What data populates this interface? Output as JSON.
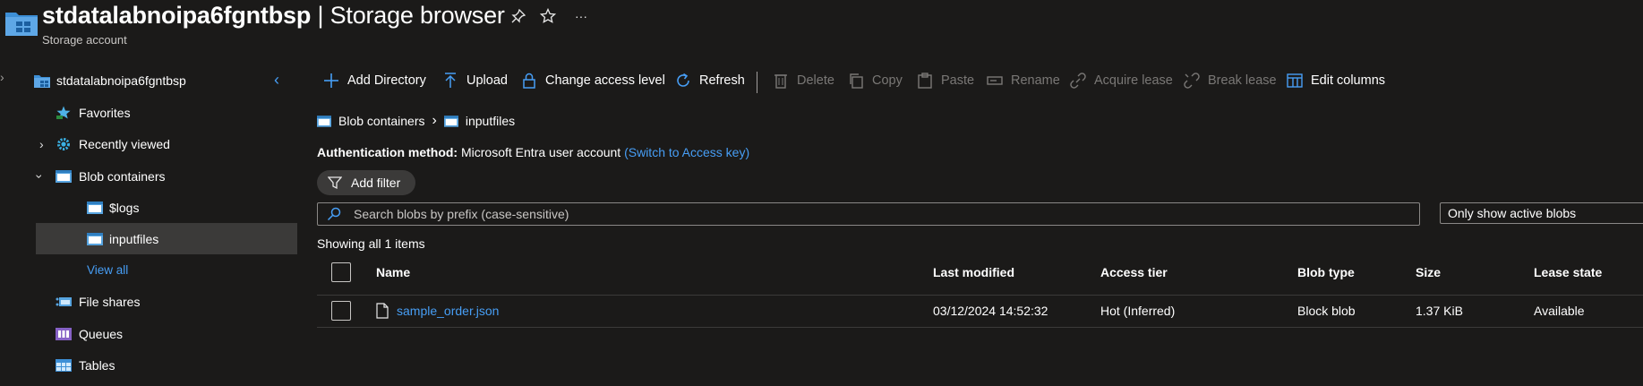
{
  "header": {
    "account_name": "stdatalabnoipa6fgntbsp",
    "separator": "|",
    "page_name": "Storage browser",
    "subtitle": "Storage account",
    "pin_icon": "pin-icon",
    "star_icon": "star-icon",
    "more_label": "···"
  },
  "sidebar": {
    "account_label": "stdatalabnoipa6fgntbsp",
    "items": [
      {
        "label": "Favorites",
        "icon": "favorites-icon"
      },
      {
        "label": "Recently viewed",
        "icon": "gear-icon"
      },
      {
        "label": "Blob containers",
        "icon": "container-icon"
      },
      {
        "label": "$logs",
        "icon": "container-icon"
      },
      {
        "label": "inputfiles",
        "icon": "container-icon"
      },
      {
        "label": "View all"
      },
      {
        "label": "File shares",
        "icon": "file-share-icon"
      },
      {
        "label": "Queues",
        "icon": "queue-icon"
      },
      {
        "label": "Tables",
        "icon": "table-icon"
      }
    ]
  },
  "toolbar": {
    "add_directory": "Add Directory",
    "upload": "Upload",
    "change_access_level": "Change access level",
    "refresh": "Refresh",
    "delete": "Delete",
    "copy": "Copy",
    "paste": "Paste",
    "rename": "Rename",
    "acquire_lease": "Acquire lease",
    "break_lease": "Break lease",
    "edit_columns": "Edit columns"
  },
  "breadcrumb": {
    "root": "Blob containers",
    "current": "inputfiles"
  },
  "auth": {
    "label": "Authentication method:",
    "value": "Microsoft Entra user account",
    "switch_link": "(Switch to Access key)"
  },
  "filter": {
    "add_filter": "Add filter"
  },
  "search": {
    "placeholder": "Search blobs by prefix (case-sensitive)"
  },
  "blob_filter": {
    "selected": "Only show active blobs"
  },
  "showing": "Showing all 1 items",
  "table": {
    "columns": [
      "Name",
      "Last modified",
      "Access tier",
      "Blob type",
      "Size",
      "Lease state"
    ],
    "rows": [
      {
        "name": "sample_order.json",
        "last_modified": "03/12/2024 14:52:32",
        "access_tier": "Hot (Inferred)",
        "blob_type": "Block blob",
        "size": "1.37 KiB",
        "lease_state": "Available"
      }
    ]
  },
  "colors": {
    "background": "#1b1a19",
    "accent": "#479ef5",
    "selected": "#3b3a39",
    "disabled": "#7a7876"
  }
}
